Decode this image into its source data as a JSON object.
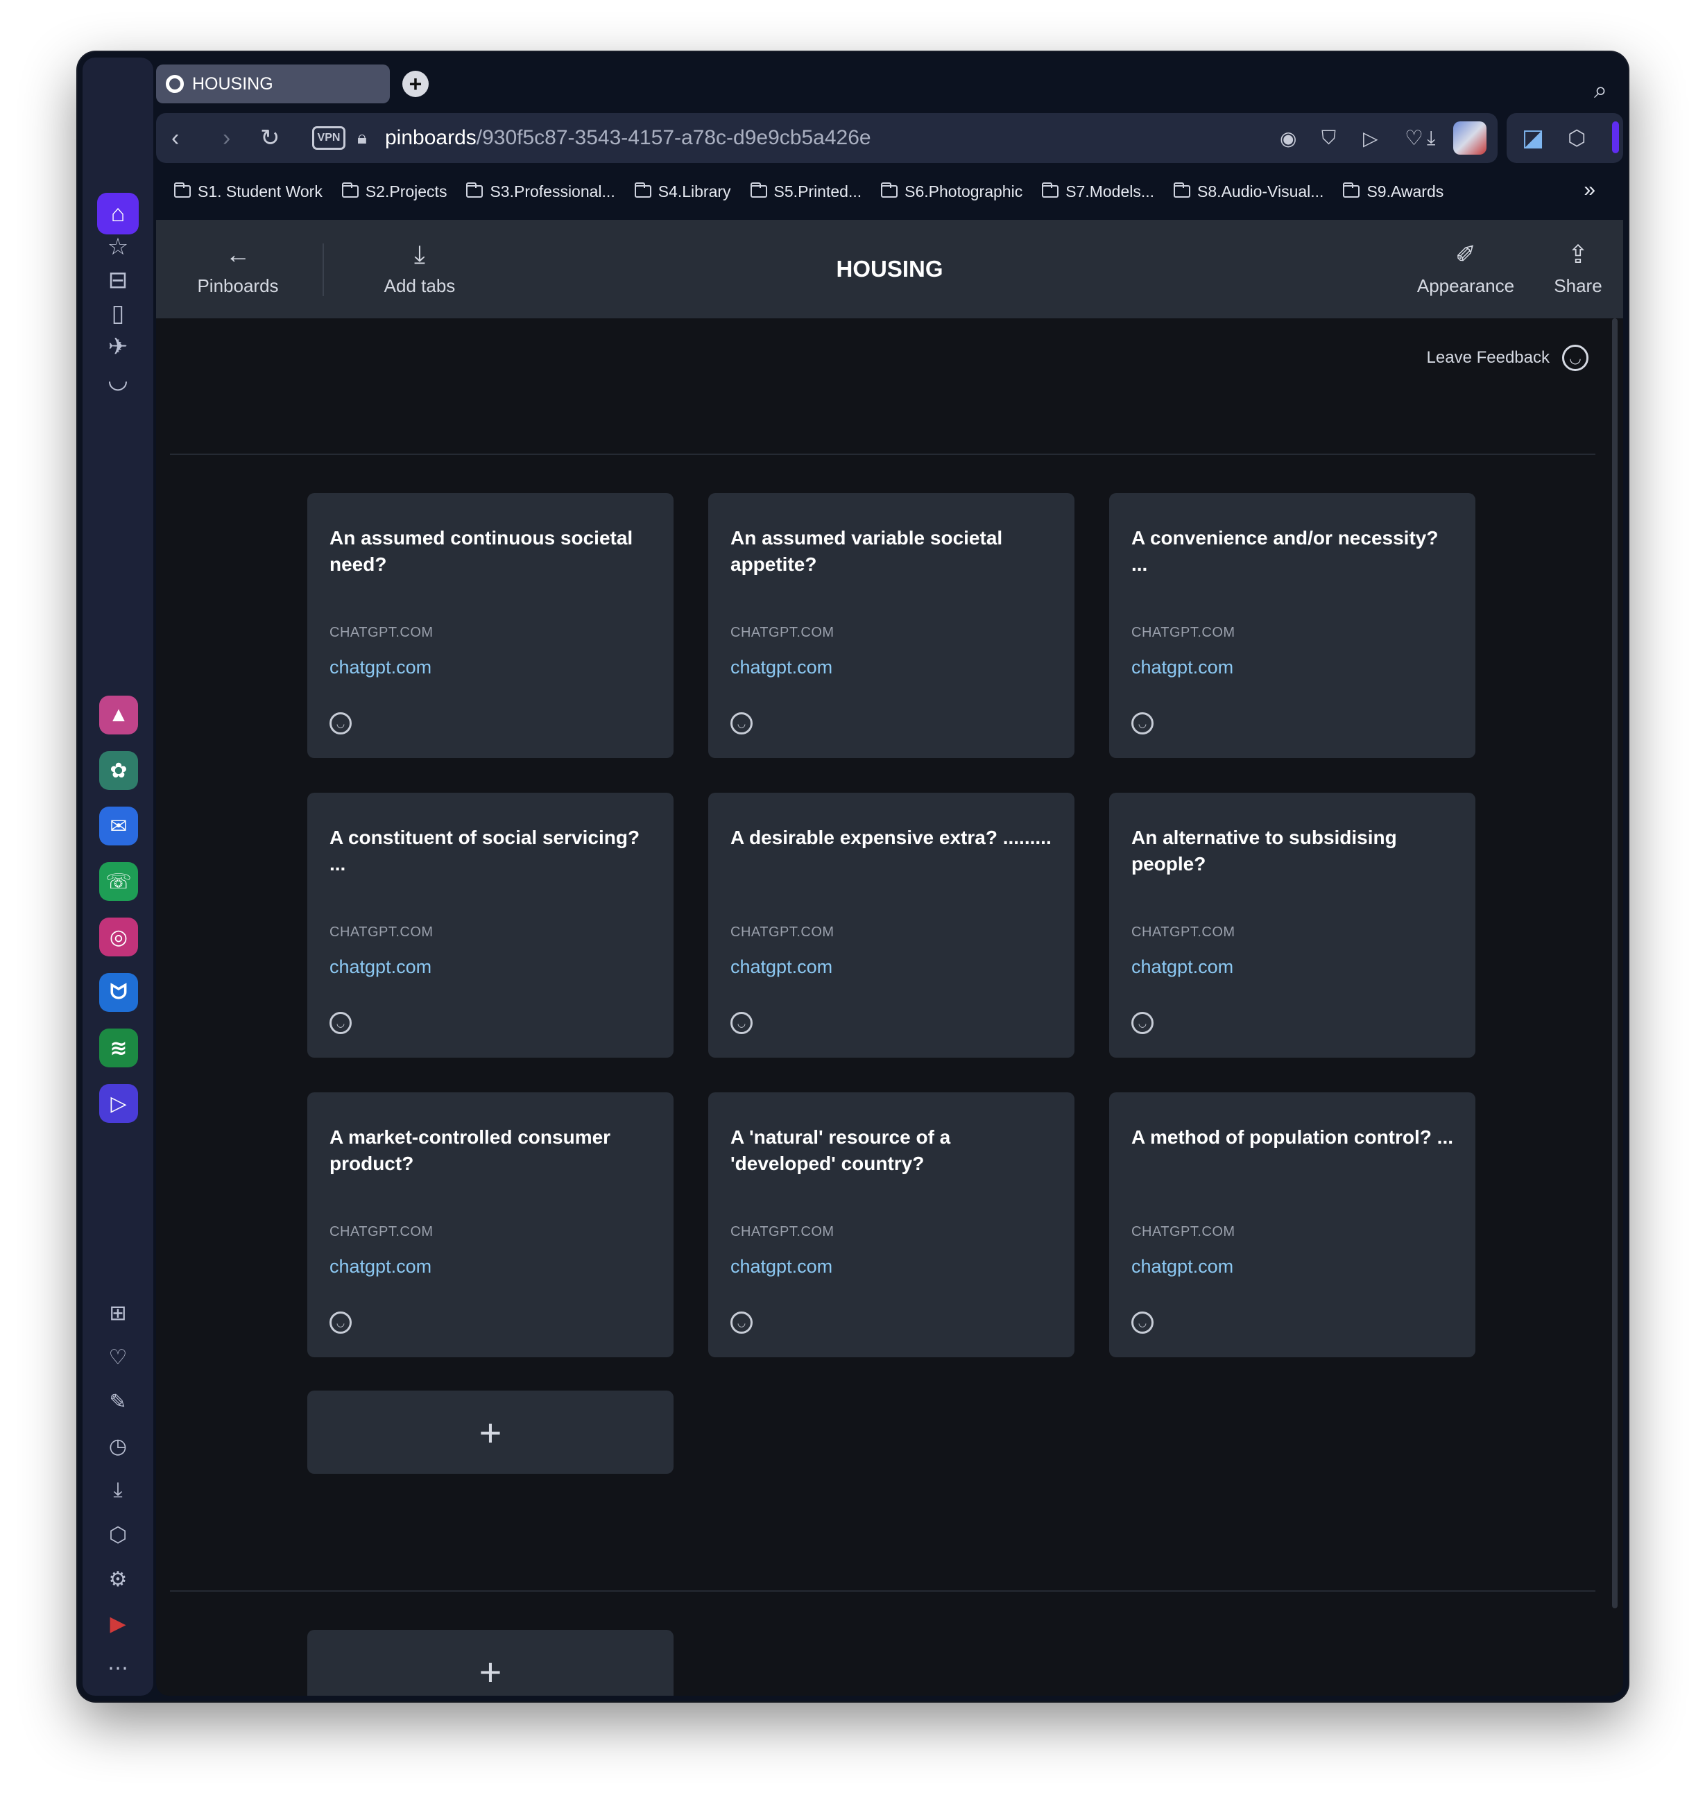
{
  "tab": {
    "title": "HOUSING"
  },
  "address": {
    "host": "pinboards",
    "path": "/930f5c87-3543-4157-a78c-d9e9cb5a426e",
    "vpn_label": "VPN"
  },
  "bookmarks": [
    "S1. Student Work",
    "S2.Projects",
    "S3.Professional...",
    "S4.Library",
    "S5.Printed...",
    "S6.Photographic",
    "S7.Models...",
    "S8.Audio-Visual...",
    "S9.Awards"
  ],
  "toolbar": {
    "pinboards_label": "Pinboards",
    "add_tabs_label": "Add tabs",
    "title": "HOUSING",
    "appearance_label": "Appearance",
    "share_label": "Share"
  },
  "feedback_label": "Leave Feedback",
  "cards": [
    {
      "title": "An assumed continuous societal need?",
      "domain": "CHATGPT.COM",
      "link": "chatgpt.com"
    },
    {
      "title": "An assumed variable societal appetite?",
      "domain": "CHATGPT.COM",
      "link": "chatgpt.com"
    },
    {
      "title": "A convenience and/or necessity? ...",
      "domain": "CHATGPT.COM",
      "link": "chatgpt.com"
    },
    {
      "title": "A constituent of social servicing? ...",
      "domain": "CHATGPT.COM",
      "link": "chatgpt.com"
    },
    {
      "title": "A desirable expensive extra? .........",
      "domain": "CHATGPT.COM",
      "link": "chatgpt.com"
    },
    {
      "title": "An alternative to subsidising people?",
      "domain": "CHATGPT.COM",
      "link": "chatgpt.com"
    },
    {
      "title": "A market-controlled consumer product?",
      "domain": "CHATGPT.COM",
      "link": "chatgpt.com"
    },
    {
      "title": "A 'natural' resource of a 'developed' country?",
      "domain": "CHATGPT.COM",
      "link": "chatgpt.com"
    },
    {
      "title": "A method of population control? ...",
      "domain": "CHATGPT.COM",
      "link": "chatgpt.com"
    }
  ],
  "add_symbol": "+",
  "colors": {
    "accent": "#5f2df0",
    "card": "#282e38",
    "link": "#8cc8f2",
    "background": "#111318"
  }
}
